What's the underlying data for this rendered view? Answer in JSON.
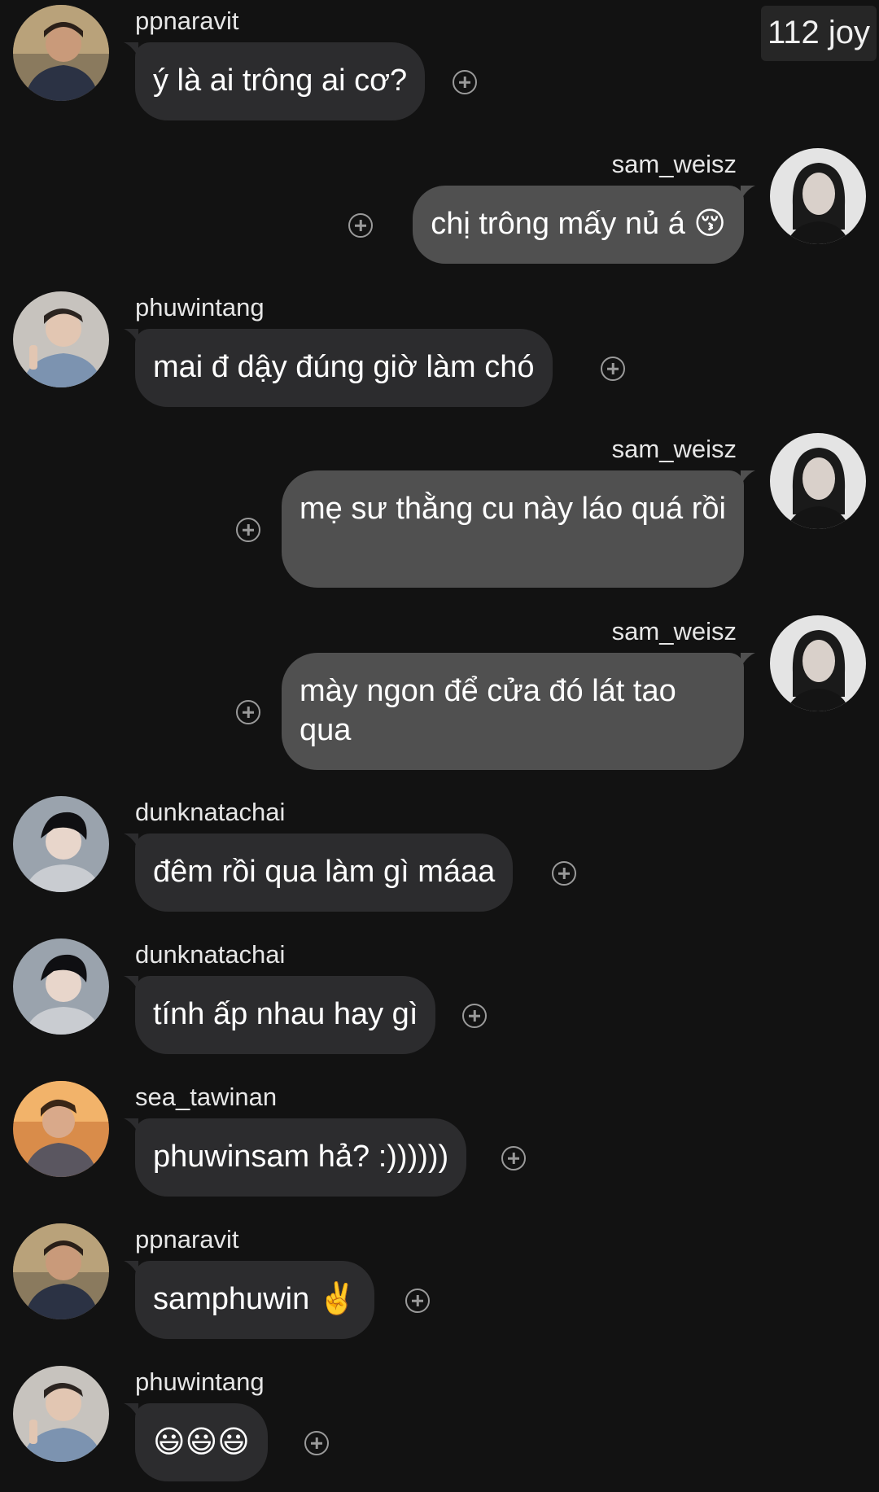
{
  "header": {
    "joy_badge": "112 joy"
  },
  "messages": [
    {
      "user": "ppnaravit",
      "side": "left",
      "text": "ý là ai trông ai cơ?",
      "avatar": "ppnaravit-avatar"
    },
    {
      "user": "sam_weisz",
      "side": "right",
      "text": "chị trông mấy nủ á 😚",
      "avatar": "sam-weisz-avatar"
    },
    {
      "user": "phuwintang",
      "side": "left",
      "text": "mai đ dậy đúng giờ làm chó",
      "avatar": "phuwintang-avatar"
    },
    {
      "user": "sam_weisz",
      "side": "right",
      "text": "mẹ sư thằng cu này láo quá rồi",
      "avatar": "sam-weisz-avatar"
    },
    {
      "user": "sam_weisz",
      "side": "right",
      "text": "mày ngon để cửa đó lát tao qua",
      "avatar": "sam-weisz-avatar"
    },
    {
      "user": "dunknatachai",
      "side": "left",
      "text": "đêm rồi qua làm gì máaa",
      "avatar": "dunknatachai-avatar"
    },
    {
      "user": "dunknatachai",
      "side": "left",
      "text": "tính ấp nhau hay gì",
      "avatar": "dunknatachai-avatar"
    },
    {
      "user": "sea_tawinan",
      "side": "left",
      "text": "phuwinsam hả? :))))))",
      "avatar": "sea-tawinan-avatar"
    },
    {
      "user": "ppnaravit",
      "side": "left",
      "text": "samphuwin ✌️",
      "avatar": "ppnaravit-avatar"
    },
    {
      "user": "phuwintang",
      "side": "left",
      "text": "😃😃😃",
      "avatar": "phuwintang-avatar"
    }
  ],
  "icons": {
    "react": "add-reaction-icon"
  },
  "colors": {
    "background": "#121212",
    "incoming_bubble": "#2c2c2e",
    "outgoing_bubble": "#505050"
  }
}
